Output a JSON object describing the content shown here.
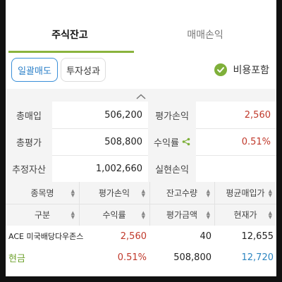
{
  "tabs": [
    {
      "label": "주식잔고",
      "active": true
    },
    {
      "label": "매매손익",
      "active": false
    }
  ],
  "toolbar": {
    "bulk_sell_label": "일괄매도",
    "performance_label": "투자성과",
    "include_fees_label": "비용포함",
    "include_fees_checked": true
  },
  "summary": {
    "total_purchase_label": "총매입",
    "total_purchase_value": "506,200",
    "eval_pl_label": "평가손익",
    "eval_pl_value": "2,560",
    "total_eval_label": "총평가",
    "total_eval_value": "508,800",
    "return_rate_label": "수익률",
    "return_rate_value": "0.51%",
    "est_assets_label": "추정자산",
    "est_assets_value": "1,002,660",
    "realized_pl_label": "실현손익",
    "realized_pl_value": ""
  },
  "table": {
    "headers_row1": [
      "종목명",
      "평가손익",
      "잔고수량",
      "평균매입가"
    ],
    "headers_row2": [
      "구분",
      "수익률",
      "평가금액",
      "현재가"
    ],
    "rows": [
      {
        "name": "ACE 미국배당다우존스",
        "type": "현금",
        "eval_pl": "2,560",
        "return_rate": "0.51%",
        "quantity": "40",
        "eval_amount": "508,800",
        "avg_price": "12,655",
        "current_price": "12,720"
      }
    ]
  },
  "colors": {
    "accent_green": "#8ab33d",
    "chip_blue": "#2a7fc8",
    "profit_red": "#c0392b",
    "price_blue": "#2e86c1"
  },
  "icons": [
    "check-circle-icon",
    "chevron-up-icon",
    "share-icon",
    "sort-icon"
  ]
}
